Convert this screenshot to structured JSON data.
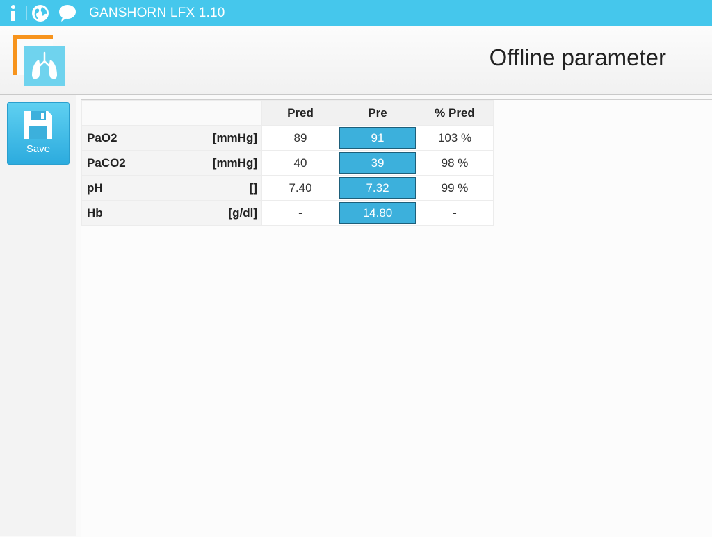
{
  "app": {
    "title": "GANSHORN LFX 1.10"
  },
  "topbar": {
    "icons": [
      "info-icon",
      "globe-icon",
      "chat-bubble-icon"
    ]
  },
  "header": {
    "title": "Offline parameter"
  },
  "toolbar": {
    "save_label": "Save"
  },
  "table": {
    "columns": [
      "Pred",
      "Pre",
      "% Pred"
    ],
    "rows": [
      {
        "name": "PaO2",
        "unit": "[mmHg]",
        "pred": "89",
        "pre": "91",
        "pct": "103 %"
      },
      {
        "name": "PaCO2",
        "unit": "[mmHg]",
        "pred": "40",
        "pre": "39",
        "pct": "98 %"
      },
      {
        "name": "pH",
        "unit": "[]",
        "pred": "7.40",
        "pre": "7.32",
        "pct": "99 %"
      },
      {
        "name": "Hb",
        "unit": "[g/dl]",
        "pred": "-",
        "pre": "14.80",
        "pct": "-"
      }
    ]
  },
  "colors": {
    "topbar": "#45c7ec",
    "accent": "#3cb0dc",
    "logo_orange": "#f7941d",
    "logo_teal": "#6fd3ee"
  }
}
